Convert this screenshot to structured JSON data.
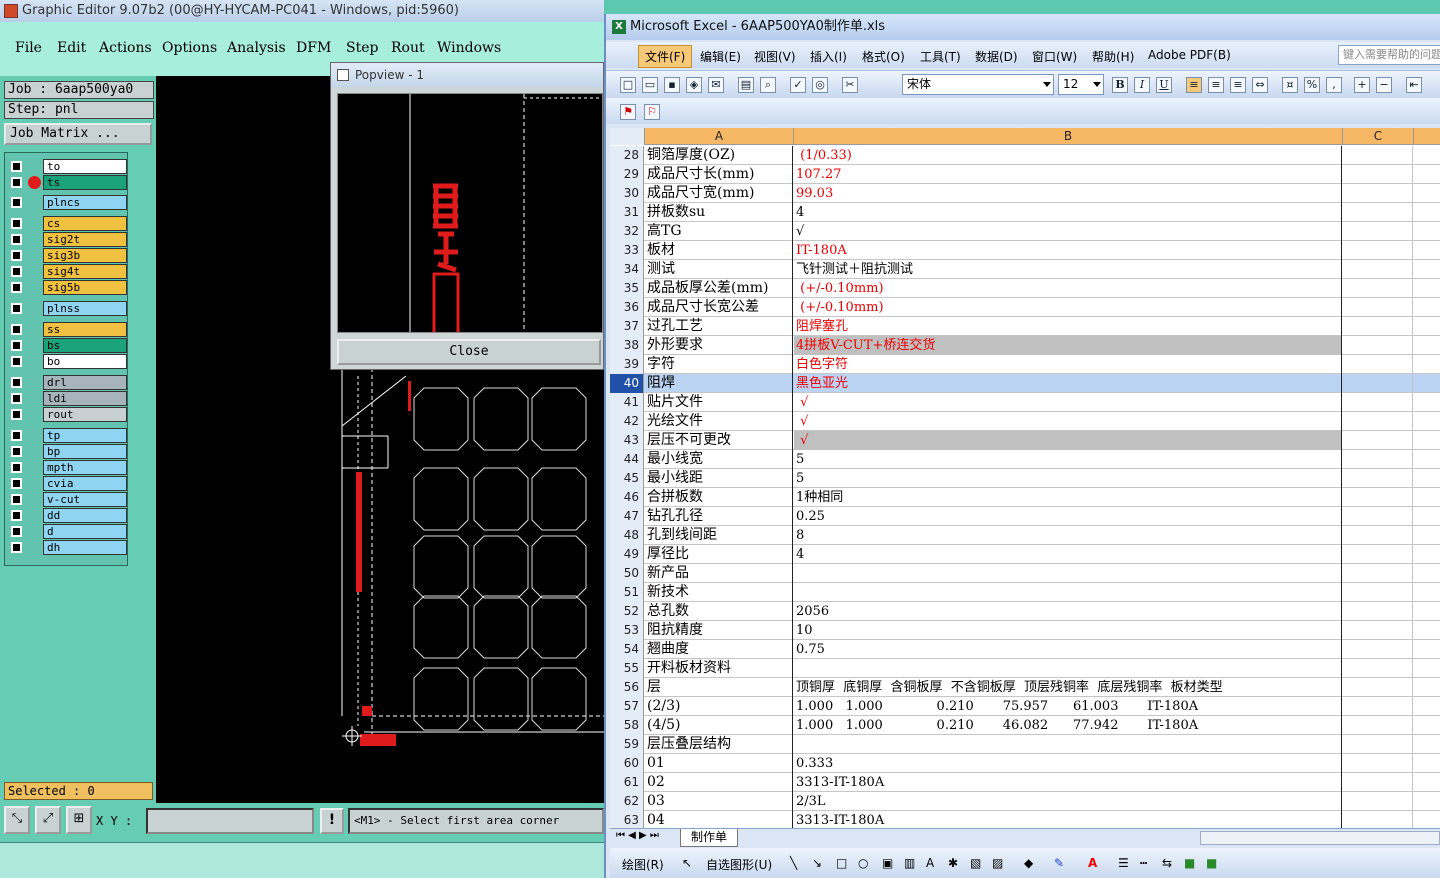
{
  "ge": {
    "title": "Graphic Editor 9.07b2 (00@HY-HYCAM-PC041 - Windows, pid:5960)",
    "menu": [
      "File",
      "Edit",
      "Actions",
      "Options",
      "Analysis",
      "DFM",
      "Step",
      "Rout",
      "Windows"
    ],
    "job": "Job  :  6aap500ya0",
    "step": "Step: pnl",
    "job_matrix": "Job Matrix ...",
    "layers": [
      {
        "name": "to",
        "color": "#ffffff"
      },
      {
        "name": "ts",
        "color": "#1aa37a",
        "active": true
      },
      {
        "name": "plncs",
        "color": "#8fd4f0"
      },
      {
        "name": "cs",
        "color": "#f0c040"
      },
      {
        "name": "sig2t",
        "color": "#f0c040"
      },
      {
        "name": "sig3b",
        "color": "#f0c040"
      },
      {
        "name": "sig4t",
        "color": "#f0c040"
      },
      {
        "name": "sig5b",
        "color": "#f0c040"
      },
      {
        "name": "plnss",
        "color": "#8fd4f0"
      },
      {
        "name": "ss",
        "color": "#f0c040"
      },
      {
        "name": "bs",
        "color": "#1aa37a"
      },
      {
        "name": "bo",
        "color": "#ffffff"
      },
      {
        "name": "drl",
        "color": "#a8b4bc"
      },
      {
        "name": "ldi",
        "color": "#a8b4bc"
      },
      {
        "name": "rout",
        "color": "#c8d0d4"
      },
      {
        "name": "tp",
        "color": "#8fd4f0"
      },
      {
        "name": "bp",
        "color": "#8fd4f0"
      },
      {
        "name": "mpth",
        "color": "#8fd4f0"
      },
      {
        "name": "cvia",
        "color": "#8fd4f0"
      },
      {
        "name": "v-cut",
        "color": "#8fd4f0"
      },
      {
        "name": "dd",
        "color": "#8fd4f0"
      },
      {
        "name": "d",
        "color": "#8fd4f0"
      },
      {
        "name": "dh",
        "color": "#8fd4f0"
      }
    ],
    "selected": "Selected : 0",
    "xy_label": "X Y :",
    "xy_value": "",
    "status": "<M1> - Select first area corner",
    "popview_title": "Popview - 1",
    "popview_close": "Close"
  },
  "xl": {
    "title": "Microsoft Excel - 6AAP500YA0制作单.xls",
    "menu": [
      "文件(F)",
      "编辑(E)",
      "视图(V)",
      "插入(I)",
      "格式(O)",
      "工具(T)",
      "数据(D)",
      "窗口(W)",
      "帮助(H)",
      "Adobe PDF(B)"
    ],
    "help_placeholder": "键入需要帮助的问题",
    "font": "宋体",
    "font_size": "12",
    "col_headers": [
      "A",
      "B",
      "C"
    ],
    "rows": [
      {
        "n": "28",
        "a": "铜箔厚度(OZ)",
        "b": " (1/0.33)",
        "red": true
      },
      {
        "n": "29",
        "a": "成品尺寸长(mm)",
        "b": "107.27",
        "red": true
      },
      {
        "n": "30",
        "a": "成品尺寸宽(mm)",
        "b": "99.03",
        "red": true
      },
      {
        "n": "31",
        "a": "拼板数su",
        "b": "4"
      },
      {
        "n": "32",
        "a": "高TG",
        "b": "√"
      },
      {
        "n": "33",
        "a": "板材",
        "b": "IT-180A",
        "red": true
      },
      {
        "n": "34",
        "a": "测试",
        "b": "飞针测试＋阻抗测试"
      },
      {
        "n": "35",
        "a": "成品板厚公差(mm)",
        "b": " (+/-0.10mm)",
        "red": true
      },
      {
        "n": "36",
        "a": "成品尺寸长宽公差",
        "b": " (+/-0.10mm)",
        "red": true
      },
      {
        "n": "37",
        "a": "过孔工艺",
        "b": "阻焊塞孔",
        "red": true
      },
      {
        "n": "38",
        "a": "外形要求",
        "b": "4拼板V-CUT+桥连交货",
        "red": true,
        "gray": true
      },
      {
        "n": "39",
        "a": "字符",
        "b": "白色字符",
        "red": true
      },
      {
        "n": "40",
        "a": "阻焊",
        "b": "黑色亚光",
        "red": true,
        "sel": true
      },
      {
        "n": "41",
        "a": "贴片文件",
        "b": " √",
        "red": true
      },
      {
        "n": "42",
        "a": "光绘文件",
        "b": " √",
        "red": true
      },
      {
        "n": "43",
        "a": "层压不可更改",
        "b": " √",
        "red": true,
        "gray": true
      },
      {
        "n": "44",
        "a": "最小线宽",
        "b": "5"
      },
      {
        "n": "45",
        "a": "最小线距",
        "b": "5"
      },
      {
        "n": "46",
        "a": "合拼板数",
        "b": "1种相同"
      },
      {
        "n": "47",
        "a": "钻孔孔径",
        "b": "0.25"
      },
      {
        "n": "48",
        "a": "孔到线间距",
        "b": "8"
      },
      {
        "n": "49",
        "a": "厚径比",
        "b": "4"
      },
      {
        "n": "50",
        "a": "新产品",
        "b": ""
      },
      {
        "n": "51",
        "a": "新技术",
        "b": ""
      },
      {
        "n": "52",
        "a": "总孔数",
        "b": "2056"
      },
      {
        "n": "53",
        "a": "阻抗精度",
        "b": "10"
      },
      {
        "n": "54",
        "a": "翘曲度",
        "b": "0.75"
      },
      {
        "n": "55",
        "a": "开料板材资料",
        "b": ""
      },
      {
        "n": "56",
        "a": "层",
        "b": "顶铜厚  底铜厚  含铜板厚  不含铜板厚  顶层残铜率  底层残铜率  板材类型"
      },
      {
        "n": "57",
        "a": "(2/3)",
        "b": "1.000   1.000             0.210       75.957      61.003       IT-180A"
      },
      {
        "n": "58",
        "a": "(4/5)",
        "b": "1.000   1.000             0.210       46.082      77.942       IT-180A"
      },
      {
        "n": "59",
        "a": "层压叠层结构",
        "b": ""
      },
      {
        "n": "60",
        "a": "01",
        "b": "0.333"
      },
      {
        "n": "61",
        "a": "02",
        "b": "3313-IT-180A"
      },
      {
        "n": "62",
        "a": "03",
        "b": "2/3L"
      },
      {
        "n": "63",
        "a": "04",
        "b": "3313-IT-180A"
      }
    ],
    "sheet_tab": "制作单",
    "draw_label": "绘图(R)",
    "autoshape_label": "自选图形(U)"
  }
}
